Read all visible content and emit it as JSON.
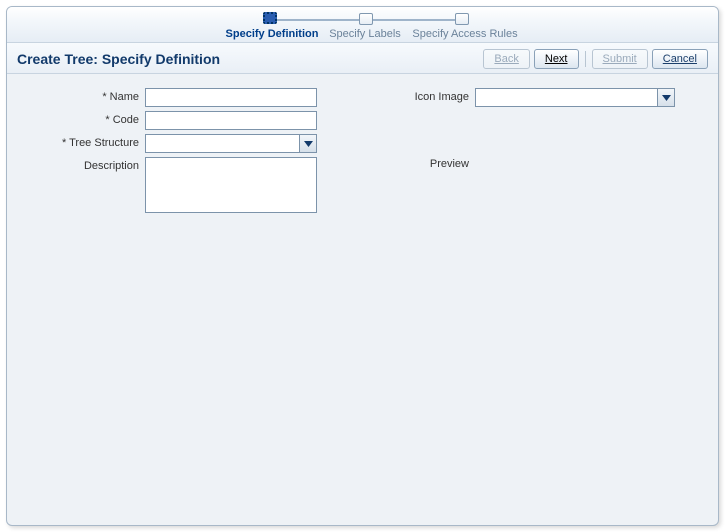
{
  "wizard": {
    "steps": [
      {
        "label": "Specify Definition",
        "current": true
      },
      {
        "label": "Specify Labels",
        "current": false
      },
      {
        "label": "Specify Access Rules",
        "current": false
      }
    ]
  },
  "header": {
    "title": "Create Tree: Specify Definition",
    "buttons": {
      "back": "Back",
      "next": "Next",
      "submit": "Submit",
      "cancel": "Cancel"
    }
  },
  "form": {
    "left": {
      "name": {
        "label": "Name",
        "value": ""
      },
      "code": {
        "label": "Code",
        "value": ""
      },
      "treeStructure": {
        "label": "Tree Structure",
        "value": ""
      },
      "description": {
        "label": "Description",
        "value": ""
      }
    },
    "right": {
      "iconImage": {
        "label": "Icon Image",
        "value": ""
      },
      "preview": {
        "label": "Preview"
      }
    }
  }
}
